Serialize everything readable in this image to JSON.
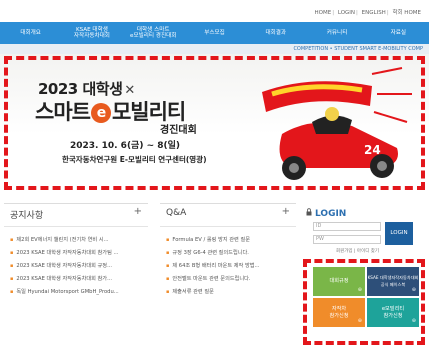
{
  "top_links": {
    "home": "HOME",
    "login": "LOGIN",
    "english": "ENGLISH",
    "home_kr": "학회 HOME"
  },
  "nav": {
    "items": [
      "대회개요",
      "KSAE 대학생\n자작자동차대회",
      "대학생 스마트\ne모빌리티 경진대회",
      "부스모집",
      "대회결과",
      "커뮤니티",
      "자료실"
    ]
  },
  "subbar_text": "COMPETITION • STUDENT SMART E-MOBILITY COMP",
  "banner": {
    "line1": "2023 대학생",
    "line2a": "스마트",
    "line2e": "e",
    "line2b": "모빌리티",
    "line3": "경진대회",
    "date": "2023. 10. 6(금) ~ 8(일)",
    "venue": "한국자동차연구원 E-모빌리티 연구센터(영광)",
    "car_number": "24"
  },
  "notice": {
    "title": "공지사항",
    "plus": "+",
    "items": [
      "제2회 EV에너지 챌린지 (전기차 연비 시...",
      "2023 KSAE 대학생 자작자동차대회 참가팀 ...",
      "2023 KSAE 대학생 자작자동차대회 규정...",
      "2023 KSAE 대학생 자작자동차대회 참가...",
      "독일 Hyundai Motorsport GMbH_Produ..."
    ]
  },
  "qa": {
    "title": "Q&A",
    "plus": "+",
    "items": [
      "Formula EV / 롤링 방지 관련 질문",
      "규정 3장 G6-4 관련 질의드립니다.",
      "제 64조 B형 배터리 마운트 제작 방법...",
      "안전벨트 마운트 관련 문의드립니다.",
      "제출서류 관련 질문"
    ]
  },
  "login": {
    "title": "LOGIN",
    "id_placeholder": "ID",
    "pw_placeholder": "PW",
    "button": "LOGIN",
    "links": "회원가입 | 아이디 찾기"
  },
  "tiles": {
    "t1": "대회규정",
    "t2": "KSAE 대학생자작자동차대회\n공식 페이스북",
    "t3": "자작차\n참가신청",
    "t4": "e모빌리티\n참가신청",
    "arrow": "⊕"
  },
  "colors": {
    "nav_blue": "#2c8ed6",
    "tile_green": "#7ab648",
    "tile_navy": "#2d4f79",
    "tile_orange": "#f08c2a",
    "tile_teal": "#1ea39a",
    "highlight_red": "#e3161b"
  }
}
